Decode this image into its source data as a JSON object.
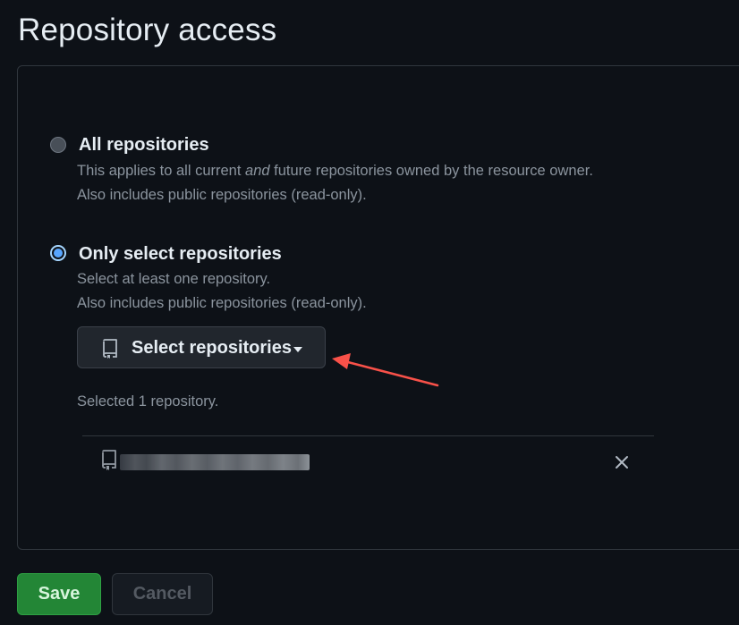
{
  "page": {
    "title": "Repository access"
  },
  "options": {
    "all": {
      "label": "All repositories",
      "desc_before": "This applies to all current ",
      "desc_emph": "and",
      "desc_after": " future repositories owned by the resource owner.",
      "desc_line2": "Also includes public repositories (read-only).",
      "selected": false
    },
    "select": {
      "label": "Only select repositories",
      "desc_line1": "Select at least one repository.",
      "desc_line2": "Also includes public repositories (read-only).",
      "selected": true
    }
  },
  "select_button": {
    "label": "Select repositories",
    "icon": "repo-icon",
    "caret_icon": "caret-down-icon"
  },
  "selected_summary": "Selected 1 repository.",
  "selected_repos": [
    {
      "name_redacted": true,
      "icon": "repo-icon",
      "remove_icon": "close-icon"
    }
  ],
  "actions": {
    "save_label": "Save",
    "cancel_label": "Cancel",
    "cancel_disabled": true
  },
  "colors": {
    "background": "#0d1117",
    "border": "#30363d",
    "accent": "#58a6ff",
    "save": "#238636",
    "annotation_arrow": "#f85149"
  }
}
